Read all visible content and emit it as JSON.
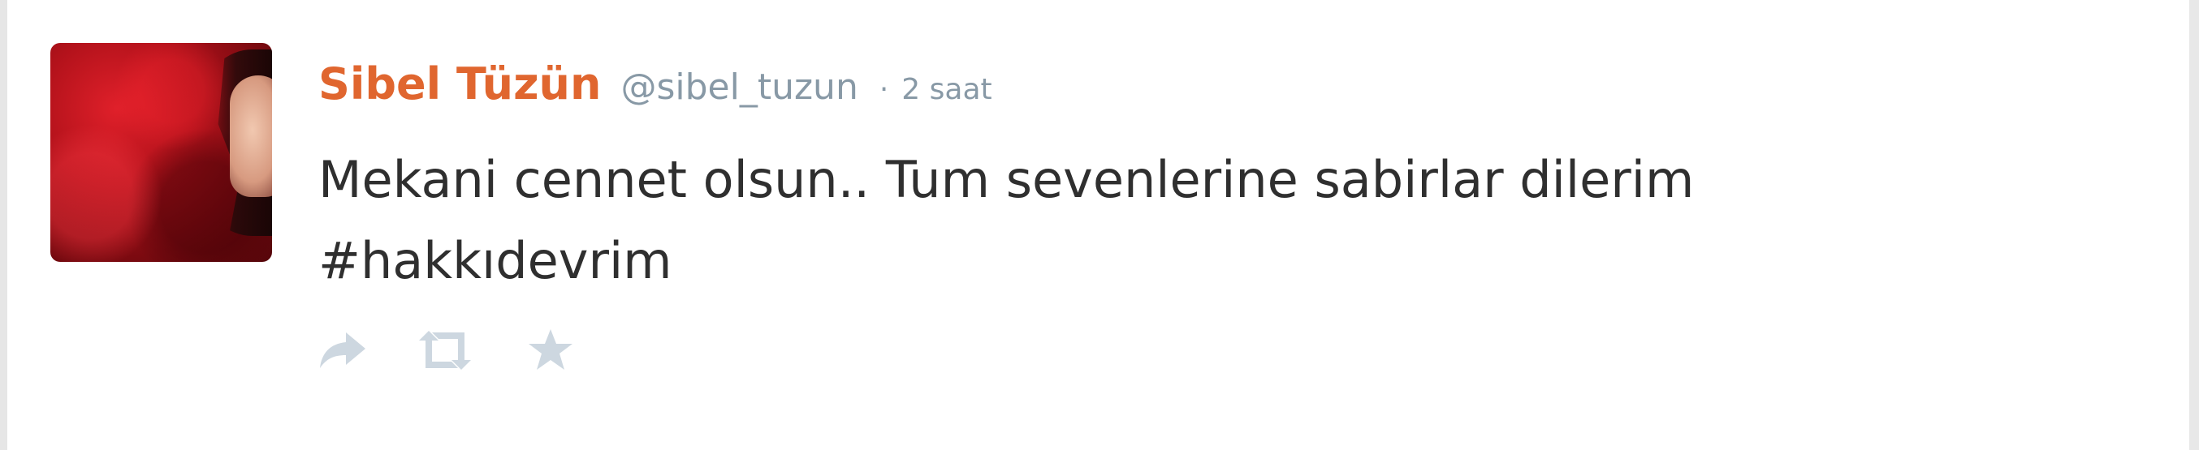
{
  "tweet": {
    "author_name": "Sibel Tüzün",
    "author_handle": "@sibel_tuzun",
    "separator": "·",
    "timestamp": "2 saat",
    "text_line1": "Mekani cennet olsun.. Tum sevenlerine sabirlar dilerim",
    "hashtag": "#hakkıdevrim",
    "avatar": "profile-photo-red",
    "actions": [
      {
        "name": "reply",
        "icon": "reply-arrow-icon"
      },
      {
        "name": "retweet",
        "icon": "retweet-icon"
      },
      {
        "name": "favorite",
        "icon": "star-icon"
      }
    ]
  },
  "colors": {
    "name": "#e0662f",
    "meta": "#8899a6",
    "text": "#2f2f2f",
    "action_icon": "#cdd7e0"
  }
}
